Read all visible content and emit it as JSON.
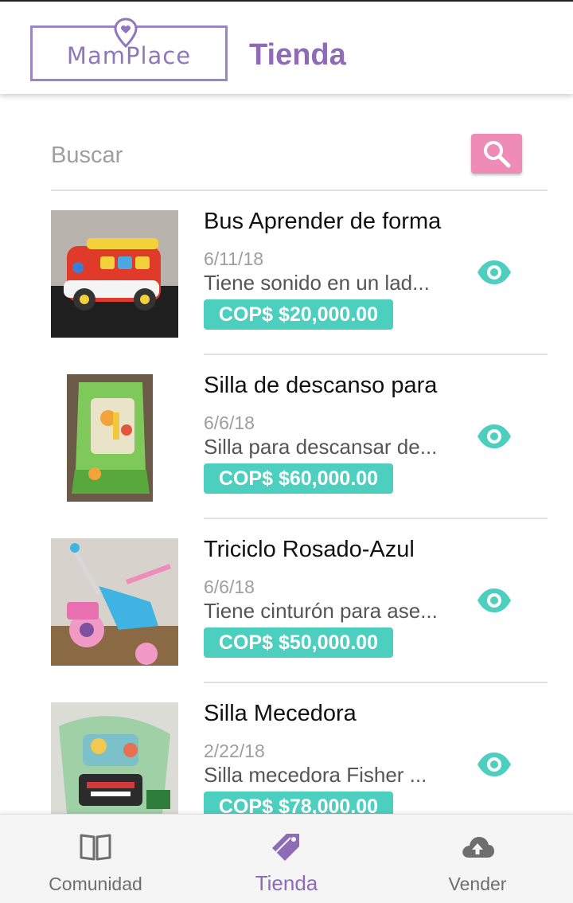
{
  "header": {
    "logo_text": "MamPlace",
    "title": "Tienda"
  },
  "search": {
    "placeholder": "Buscar",
    "value": ""
  },
  "products": [
    {
      "title": "Bus Aprender de forma",
      "date": "6/11/18",
      "description": "Tiene sonido en un lad...",
      "price": "COP$ $20,000.00"
    },
    {
      "title": "Silla de descanso para",
      "date": "6/6/18",
      "description": "Silla para descansar de...",
      "price": "COP$ $60,000.00"
    },
    {
      "title": "Triciclo Rosado-Azul",
      "date": "6/6/18",
      "description": "Tiene cinturón para ase...",
      "price": "COP$ $50,000.00"
    },
    {
      "title": "Silla Mecedora",
      "date": "2/22/18",
      "description": "Silla mecedora Fisher ...",
      "price": "COP$ $78,000.00"
    }
  ],
  "bottom_nav": {
    "items": [
      {
        "label": "Comunidad",
        "icon": "book-icon"
      },
      {
        "label": "Tienda",
        "icon": "tag-icon"
      },
      {
        "label": "Vender",
        "icon": "cloud-upload-icon"
      }
    ],
    "active": "Tienda"
  },
  "colors": {
    "brand_purple": "#8e6bb5",
    "accent_teal": "#4dcfc0",
    "search_pink": "#ef8bb7"
  }
}
